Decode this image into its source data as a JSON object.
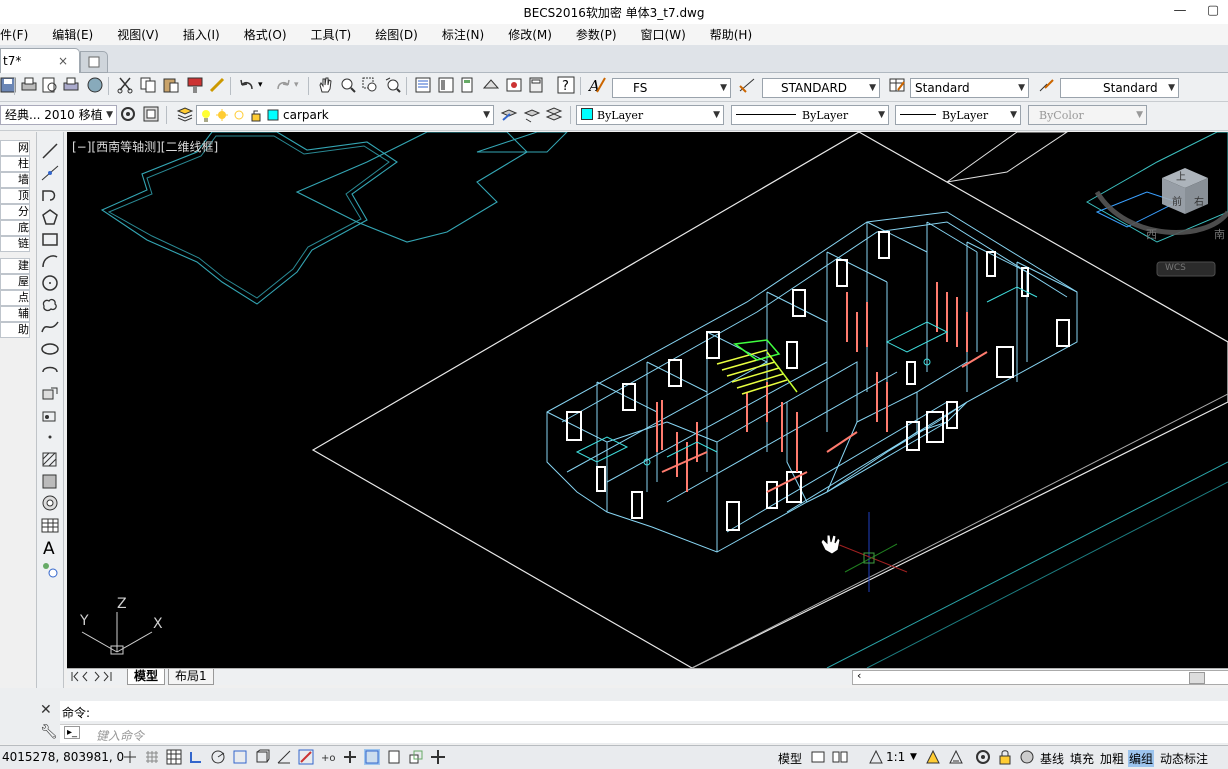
{
  "window": {
    "title": "BECS2016软加密     单体3_t7.dwg"
  },
  "menu": [
    {
      "label": "件(F)"
    },
    {
      "label": "编辑(E)"
    },
    {
      "label": "视图(V)"
    },
    {
      "label": "插入(I)"
    },
    {
      "label": "格式(O)"
    },
    {
      "label": "工具(T)"
    },
    {
      "label": "绘图(D)"
    },
    {
      "label": "标注(N)"
    },
    {
      "label": "修改(M)"
    },
    {
      "label": "参数(P)"
    },
    {
      "label": "窗口(W)"
    },
    {
      "label": "帮助(H)"
    }
  ],
  "tabs": {
    "active_doc": "t7*",
    "close": "×"
  },
  "toolbar1": {
    "text_style": "FS",
    "dim_style": "STANDARD",
    "table_style": "Standard",
    "mleader_style": "Standard"
  },
  "toolbar2": {
    "workspace": "经典... 2010 移植",
    "layer": "carpark",
    "color": "ByLayer",
    "linetype": "ByLayer",
    "lineweight": "ByLayer",
    "plotstyle": "ByColor"
  },
  "left_panel": {
    "items": [
      "网",
      "柱",
      "墙",
      "顶",
      "分",
      "底",
      "链",
      "建",
      "屋",
      "点",
      "辅",
      "助"
    ]
  },
  "viewport": {
    "label": "[−][西南等轴测][二维线框]",
    "ucs": {
      "x": "X",
      "y": "Y",
      "z": "Z"
    },
    "viewcube": {
      "face_top": "上",
      "face_front": "前",
      "face_right": "右",
      "compass_w": "西",
      "compass_s": "南",
      "wcs_button": "WCS"
    }
  },
  "layout_tabs": {
    "model": "模型",
    "layout1": "布局1"
  },
  "command": {
    "prompt": "命令:",
    "input_placeholder": "键入命令"
  },
  "status": {
    "coords": "4015278, 803981, 0",
    "model": "模型",
    "scale": "1:1",
    "buttons": [
      "基线",
      "填充",
      "加粗",
      "编组",
      "动态标注"
    ]
  },
  "colors": {
    "canvas": "#000000",
    "building": "#8fe0ff",
    "outline": "#cfe8e8",
    "accent_red": "#ff7b6e",
    "stair_yellow": "#e8ff40",
    "stair_green": "#40ff40"
  }
}
